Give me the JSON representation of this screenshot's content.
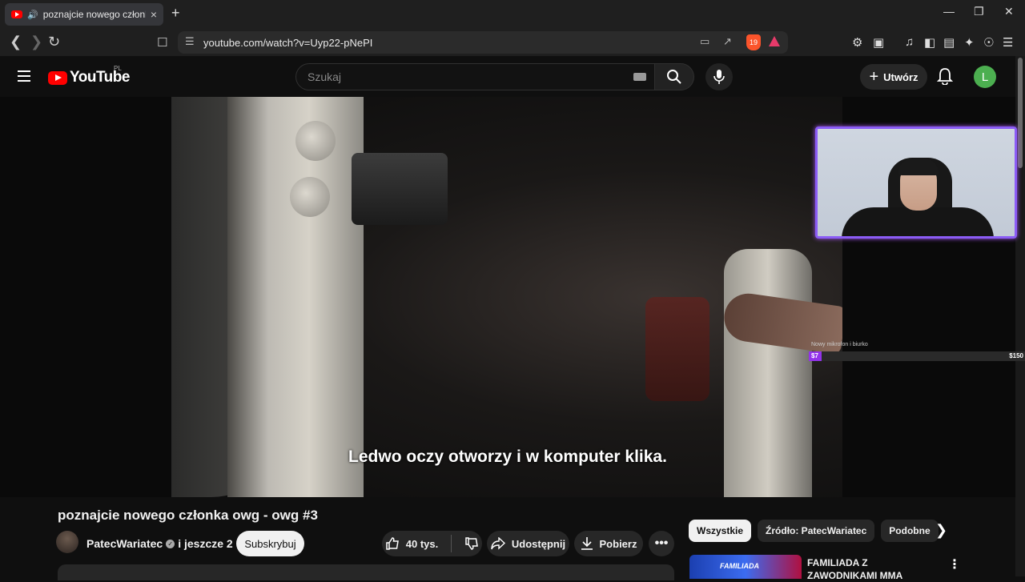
{
  "browser": {
    "tab_title": "poznajcie nowego członka ow",
    "tab_close": "×",
    "new_tab": "+",
    "url": "youtube.com/watch?v=Uyp22-pNePI",
    "brave_count": "19"
  },
  "youtube": {
    "logo_text": "YouTube",
    "country_code": "PL",
    "search_placeholder": "Szukaj",
    "create_label": "Utwórz",
    "avatar_letter": "L"
  },
  "player": {
    "subtitle": "Ledwo oczy otworzy i w komputer klika.",
    "goal": {
      "label": "Nowy mikrofon i biurko",
      "current": "$7",
      "target": "$150",
      "progress_fraction": 0.047
    }
  },
  "video": {
    "title": "poznajcie nowego członka owg - owg #3",
    "channel": "PatecWariatec",
    "and_more": "i jeszcze 2",
    "subscribe_label": "Subskrybuj",
    "likes": "40 tys.",
    "share_label": "Udostępnij",
    "download_label": "Pobierz"
  },
  "sidebar": {
    "chips": [
      "Wszystkie",
      "Źródło: PatecWariatec",
      "Podobne"
    ],
    "active_chip": 0,
    "recommended": [
      {
        "title": "FAMILIADA Z ZAWODNIKAMI MMA",
        "thumb_text": "FAMILIADA"
      }
    ]
  },
  "icons": {
    "colors": {
      "accent": "#ff0000",
      "goal_bar": "#9333ea",
      "cam_border": "#8b5cf6",
      "avatar": "#4caf50"
    }
  }
}
